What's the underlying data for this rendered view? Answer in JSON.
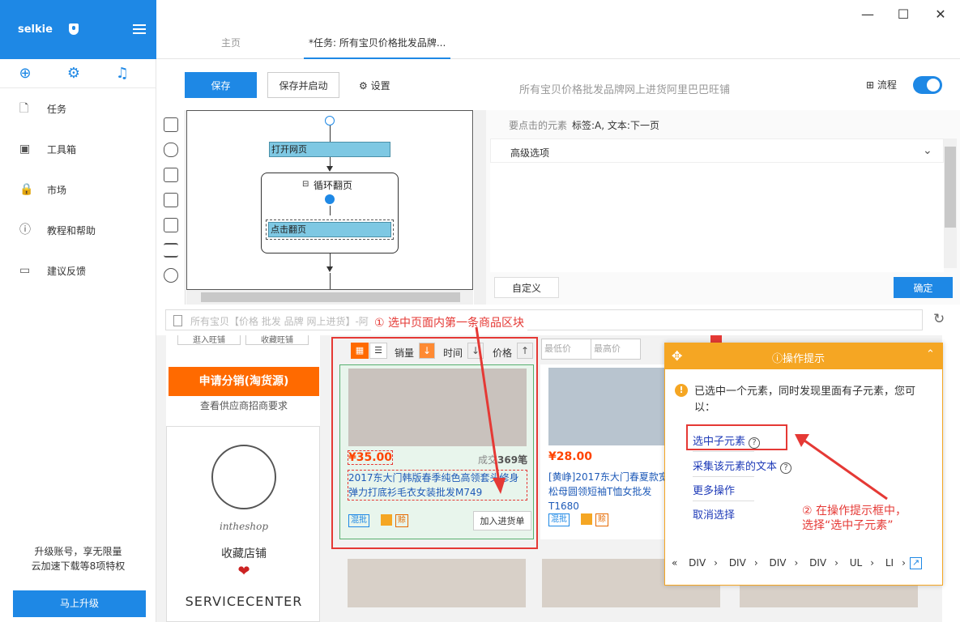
{
  "sidebar": {
    "brand": "selkie",
    "items": [
      {
        "label": "任务",
        "icon": "document-icon"
      },
      {
        "label": "工具箱",
        "icon": "toolbox-icon"
      },
      {
        "label": "市场",
        "icon": "lock-icon"
      },
      {
        "label": "教程和帮助",
        "icon": "help-circle-icon"
      },
      {
        "label": "建议反馈",
        "icon": "chat-icon"
      }
    ],
    "promo_line1": "升级账号，享无限量",
    "promo_line2": "云加速下载等8项特权",
    "upgrade_label": "马上升级"
  },
  "tabs": {
    "home": "主页",
    "task": "*任务: 所有宝贝价格批发品牌..."
  },
  "toolbar": {
    "save": "保存",
    "save_run": "保存并启动",
    "settings": "设置",
    "task_name": "所有宝贝价格批发品牌网上进货阿里巴巴旺铺",
    "flow": "流程"
  },
  "workflow": {
    "open_page": "打开网页",
    "loop": "循环翻页",
    "click": "点击翻页"
  },
  "panel": {
    "header_label": "要点击的元素",
    "header_value": "标签:A, 文本:下一页",
    "advanced": "高级选项",
    "custom": "自定义",
    "ok": "确定"
  },
  "urlbar": {
    "text": "所有宝贝【价格 批发 品牌 网上进货】-阿"
  },
  "shop": {
    "apply": "申请分销(淘货源)",
    "apply_sub": "查看供应商招商要求",
    "name": "intheshop",
    "favorite": "收藏店铺",
    "service": "SERVICECENTER",
    "top_btn1": "逛入旺铺",
    "top_btn2": "收藏旺铺"
  },
  "sort": {
    "sales": "销量",
    "time": "时间",
    "price": "价格",
    "min": "最低价",
    "max": "最高价",
    "sep": "-"
  },
  "products": [
    {
      "price": "¥35.00",
      "deal_prefix": "成交",
      "deal": "369笔",
      "title": "2017东大门韩版春季纯色高领套头修身弹力打底衫毛衣女装批发M749",
      "badge1": "混批",
      "badge2": "赊",
      "add": "加入进货单"
    },
    {
      "price": "¥28.00",
      "title": "[黄峥]2017东大门春夏款宽松母圆领短袖T恤女批发T1680",
      "badge1": "混批",
      "badge2": "赊"
    }
  ],
  "tip": {
    "title": "操作提示",
    "message": "已选中一个元素，同时发现里面有子元素，您可以：",
    "options": [
      "选中子元素",
      "采集该元素的文本",
      "更多操作",
      "取消选择"
    ],
    "crumbs": [
      "DIV",
      "DIV",
      "DIV",
      "DIV",
      "UL",
      "LI"
    ]
  },
  "annotations": {
    "step1": "① 选中页面内第一条商品区块",
    "step2_line1": "② 在操作提示框中，",
    "step2_line2": "选择“选中子元素”"
  },
  "colors": {
    "accent": "#1e88e5",
    "warning": "#f5a623",
    "annotation": "#e53935",
    "price": "#ff4400"
  }
}
